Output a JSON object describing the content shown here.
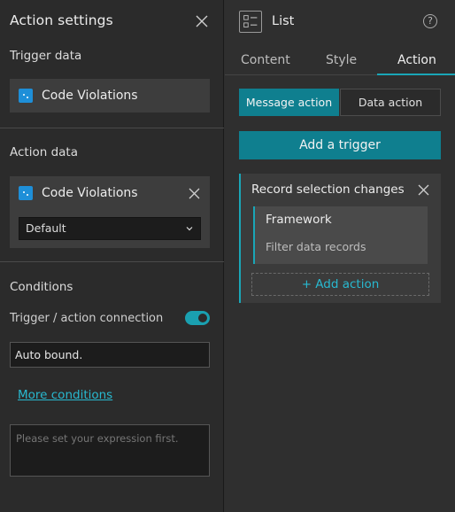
{
  "left_panel": {
    "title": "Action settings",
    "trigger_section": {
      "title": "Trigger data",
      "source": "Code Violations"
    },
    "action_section": {
      "title": "Action data",
      "source": "Code Violations",
      "view_select": "Default"
    },
    "conditions": {
      "title": "Conditions",
      "toggle_label": "Trigger / action connection",
      "toggle_on": true,
      "auto_bound_value": "Auto bound.",
      "more_link": "More conditions",
      "expression_placeholder": "Please set your expression first."
    }
  },
  "right_panel": {
    "title": "List",
    "help_glyph": "?",
    "tabs": [
      {
        "label": "Content",
        "active": false
      },
      {
        "label": "Style",
        "active": false
      },
      {
        "label": "Action",
        "active": true
      }
    ],
    "segments": {
      "message": "Message action",
      "data": "Data action"
    },
    "add_trigger_label": "Add a trigger",
    "trigger_card": {
      "title": "Record selection changes",
      "framework": {
        "title": "Framework",
        "subtitle": "Filter data records"
      },
      "add_action_label": "+ Add action"
    }
  },
  "colors": {
    "accent": "#1aa6b7",
    "link": "#28b9d0",
    "datasource_icon": "#1e8fd8"
  }
}
